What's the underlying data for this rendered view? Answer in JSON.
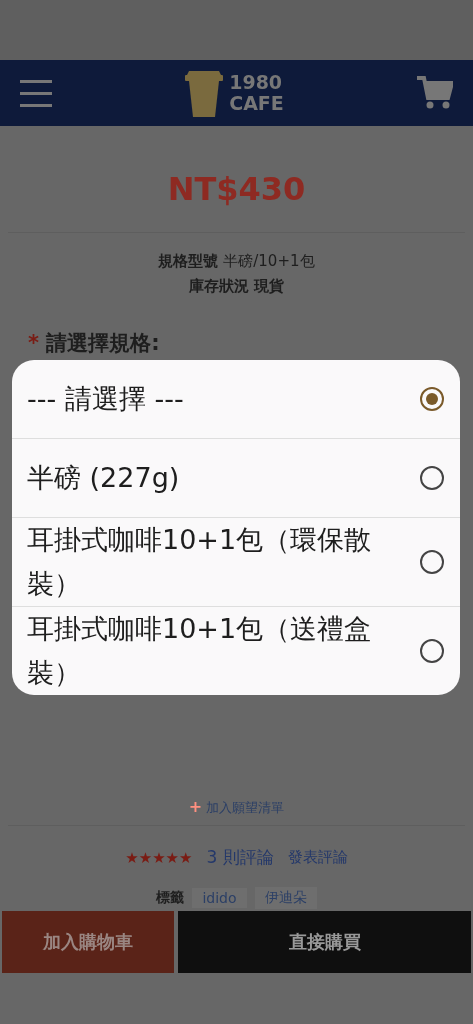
{
  "header": {
    "logo": {
      "line_1": "1980",
      "line_2": "CAFE"
    }
  },
  "product": {
    "price": "NT$430",
    "spec": {
      "label": "規格型號",
      "value": "半磅/10+1包"
    },
    "stock": {
      "label": "庫存狀況",
      "value": "現貨"
    },
    "option_label": {
      "required": "*",
      "text": "請選擇規格:"
    }
  },
  "picker": {
    "options": [
      {
        "label": "--- 請選擇 ---",
        "selected": true
      },
      {
        "label": "半磅 (227g)",
        "selected": false
      },
      {
        "label": "耳掛式咖啡10+1包（環保散裝）",
        "selected": false
      },
      {
        "label": "耳掛式咖啡10+1包（送禮盒裝）",
        "selected": false
      }
    ]
  },
  "wishlist": {
    "icon": "+",
    "text": "加入願望清單"
  },
  "reviews": {
    "stars": 5,
    "count": "3 則評論",
    "write": "發表評論"
  },
  "tags": {
    "label": "標籤",
    "items": [
      "idido",
      "伊迪朵"
    ]
  },
  "actions": {
    "add_to_cart": "加入購物車",
    "buy_now": "直接購買"
  }
}
